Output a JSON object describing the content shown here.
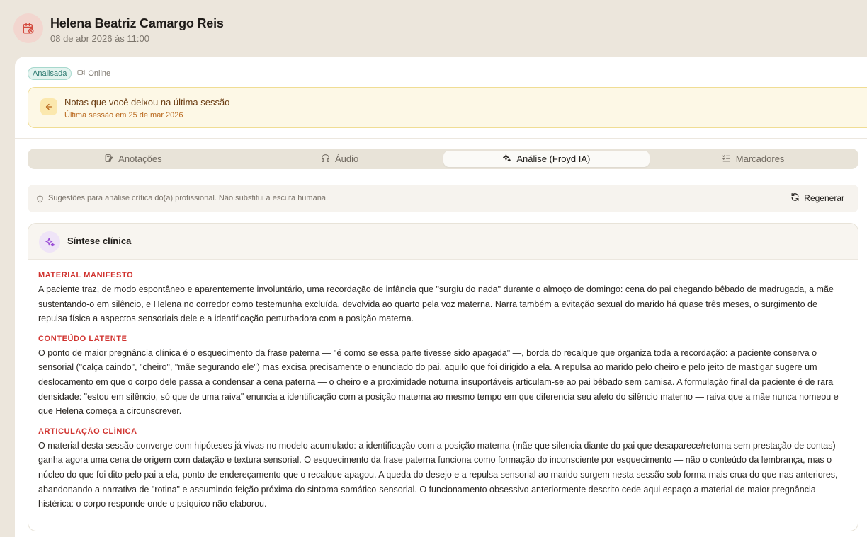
{
  "header": {
    "patient_name": "Helena Beatriz Camargo Reis",
    "session_datetime": "08 de abr 2026 às 11:00",
    "icon": "calendar-clock-icon"
  },
  "status": {
    "badge": "Analisada",
    "mode": "Online"
  },
  "notes_banner": {
    "title": "Notas que você deixou na última sessão",
    "subtitle": "Última sessão em 25 de mar 2026"
  },
  "tabs": [
    {
      "label": "Anotações",
      "icon": "notes-edit-icon",
      "active": false
    },
    {
      "label": "Áudio",
      "icon": "headphones-icon",
      "active": false
    },
    {
      "label": "Análise (Froyd IA)",
      "icon": "sparkles-icon",
      "active": true
    },
    {
      "label": "Marcadores",
      "icon": "checklist-icon",
      "active": false
    }
  ],
  "disclaimer": {
    "text": "Sugestões para análise crítica do(a) profissional. Não substitui a escuta humana.",
    "regenerate_label": "Regenerar"
  },
  "synthesis": {
    "title": "Síntese clínica",
    "sections": [
      {
        "title": "MATERIAL MANIFESTO",
        "text": "A paciente traz, de modo espontâneo e aparentemente involuntário, uma recordação de infância que \"surgiu do nada\" durante o almoço de domingo: cena do pai chegando bêbado de madrugada, a mãe sustentando-o em silêncio, e Helena no corredor como testemunha excluída, devolvida ao quarto pela voz materna. Narra também a evitação sexual do marido há quase três meses, o surgimento de repulsa física a aspectos sensoriais dele e a identificação perturbadora com a posição materna."
      },
      {
        "title": "CONTEÚDO LATENTE",
        "text": "O ponto de maior pregnância clínica é o esquecimento da frase paterna — \"é como se essa parte tivesse sido apagada\" —, borda do recalque que organiza toda a recordação: a paciente conserva o sensorial (\"calça caindo\", \"cheiro\", \"mãe segurando ele\") mas excisa precisamente o enunciado do pai, aquilo que foi dirigido a ela. A repulsa ao marido pelo cheiro e pelo jeito de mastigar sugere um deslocamento em que o corpo dele passa a condensar a cena paterna — o cheiro e a proximidade noturna insuportáveis articulam-se ao pai bêbado sem camisa. A formulação final da paciente é de rara densidade: \"estou em silêncio, só que de uma raiva\" enuncia a identificação com a posição materna ao mesmo tempo em que diferencia seu afeto do silêncio materno — raiva que a mãe nunca nomeou e que Helena começa a circunscrever."
      },
      {
        "title": "ARTICULAÇÃO CLÍNICA",
        "text": "O material desta sessão converge com hipóteses já vivas no modelo acumulado: a identificação com a posição materna (mãe que silencia diante do pai que desaparece/retorna sem prestação de contas) ganha agora uma cena de origem com datação e textura sensorial. O esquecimento da frase paterna funciona como formação do inconsciente por esquecimento — não o conteúdo da lembrança, mas o núcleo do que foi dito pelo pai a ela, ponto de endereçamento que o recalque apagou. A queda do desejo e a repulsa sensorial ao marido surgem nesta sessão sob forma mais crua do que nas anteriores, abandonando a narrativa de \"rotina\" e assumindo feição próxima do sintoma somático-sensorial. O funcionamento obsessivo anteriormente descrito cede aqui espaço a material de maior pregnância histérica: o corpo responde onde o psíquico não elaborou."
      }
    ]
  },
  "colors": {
    "background": "#ece6dc",
    "accent_red": "#d0332f",
    "badge_teal": "#2c7a70",
    "banner_yellow": "#fdf8e6"
  }
}
